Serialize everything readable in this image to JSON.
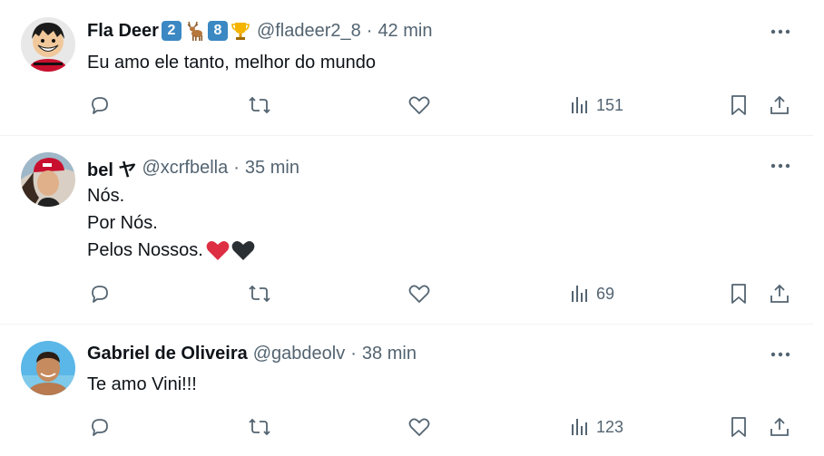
{
  "tweets": [
    {
      "name": "Fla Deer",
      "badges": [
        "2",
        "8"
      ],
      "handle": "@fladeer2_8",
      "dot": "·",
      "time": "42 min",
      "lines": [
        "Eu amo ele tanto, melhor do mundo"
      ],
      "views": "151",
      "avatar_icon": "cartoon-avatar"
    },
    {
      "name": "bel ヤ",
      "handle": "@xcrfbella",
      "dot": "·",
      "time": "35 min",
      "lines": [
        "Nós.",
        "Por Nós.",
        "Pelos Nossos."
      ],
      "views": "69",
      "avatar_icon": "photo-avatar"
    },
    {
      "name": "Gabriel de Oliveira",
      "handle": "@gabdeolv",
      "dot": "·",
      "time": "38 min",
      "lines": [
        "Te amo Vini!!!"
      ],
      "views": "123",
      "avatar_icon": "photo-avatar"
    }
  ],
  "colors": {
    "text": "#0f1419",
    "secondary": "#536471",
    "divider": "#eff3f4",
    "badge": "#3b88c3"
  }
}
